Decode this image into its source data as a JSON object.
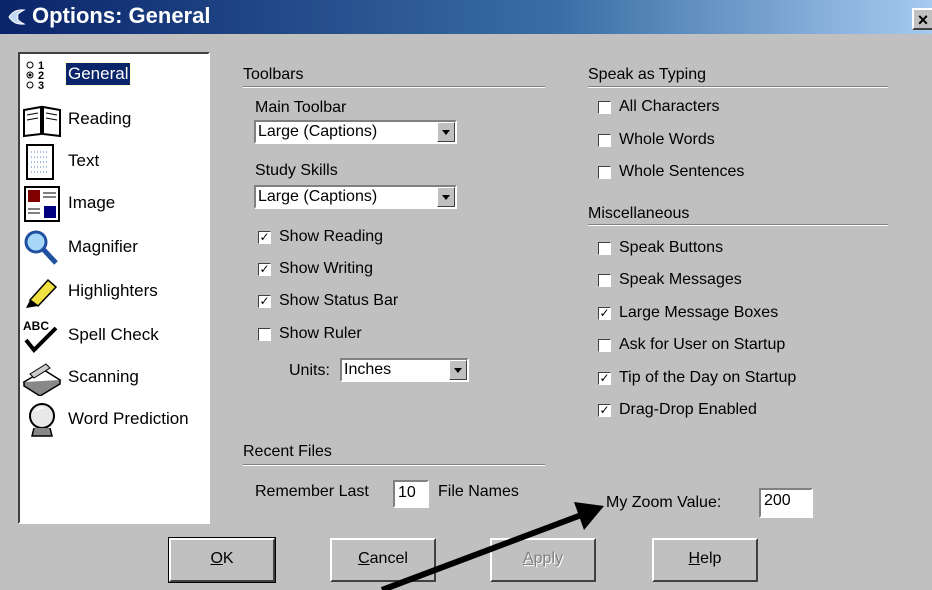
{
  "window": {
    "title": "Options: General",
    "close_glyph": "×"
  },
  "sidebar": {
    "items": [
      {
        "label": "General",
        "icon": "list-options-icon",
        "selected": true
      },
      {
        "label": "Reading",
        "icon": "book-icon"
      },
      {
        "label": "Text",
        "icon": "document-icon"
      },
      {
        "label": "Image",
        "icon": "picture-icon"
      },
      {
        "label": "Magnifier",
        "icon": "magnifier-icon"
      },
      {
        "label": "Highlighters",
        "icon": "highlighter-icon"
      },
      {
        "label": "Spell Check",
        "icon": "spellcheck-icon"
      },
      {
        "label": "Scanning",
        "icon": "scanner-icon"
      },
      {
        "label": "Word Prediction",
        "icon": "crystal-ball-icon"
      }
    ]
  },
  "toolbars": {
    "title": "Toolbars",
    "main_toolbar_label": "Main Toolbar",
    "main_toolbar_value": "Large (Captions)",
    "study_skills_label": "Study Skills",
    "study_skills_value": "Large (Captions)",
    "checkboxes": [
      {
        "label": "Show Reading",
        "checked": true
      },
      {
        "label": "Show Writing",
        "checked": true
      },
      {
        "label": "Show Status Bar",
        "checked": true
      },
      {
        "label": "Show Ruler",
        "checked": false
      }
    ],
    "units_label": "Units:",
    "units_value": "Inches"
  },
  "recent_files": {
    "title": "Recent Files",
    "remember_label": "Remember Last",
    "remember_value": "10",
    "suffix_label": "File Names"
  },
  "speak_as_typing": {
    "title": "Speak as Typing",
    "checkboxes": [
      {
        "label": "All Characters",
        "checked": false
      },
      {
        "label": "Whole Words",
        "checked": false
      },
      {
        "label": "Whole Sentences",
        "checked": false
      }
    ]
  },
  "miscellaneous": {
    "title": "Miscellaneous",
    "checkboxes": [
      {
        "label": "Speak Buttons",
        "checked": false
      },
      {
        "label": "Speak Messages",
        "checked": false
      },
      {
        "label": "Large Message Boxes",
        "checked": true
      },
      {
        "label": "Ask for User on Startup",
        "checked": false
      },
      {
        "label": "Tip of the Day on Startup",
        "checked": true
      },
      {
        "label": "Drag-Drop Enabled",
        "checked": true
      }
    ]
  },
  "zoom": {
    "label": "My Zoom Value:",
    "value": "200"
  },
  "buttons": {
    "ok": {
      "mnemonic": "O",
      "rest": "K"
    },
    "cancel": {
      "mnemonic": "C",
      "rest": "ancel"
    },
    "apply": {
      "mnemonic": "A",
      "rest": "pply",
      "disabled": true
    },
    "help": {
      "mnemonic": "H",
      "rest": "elp"
    }
  },
  "check_glyph": "✓"
}
